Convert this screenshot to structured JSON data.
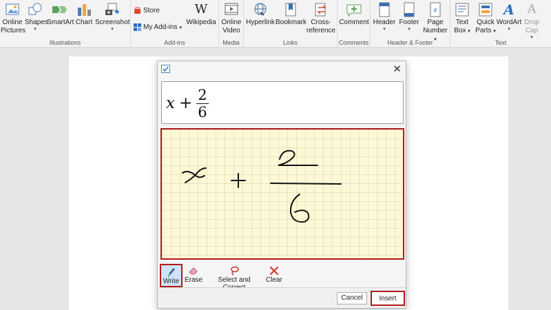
{
  "ribbon": {
    "illustrations": {
      "label": "Illustrations",
      "online_pictures": "Online Pictures",
      "shapes": "Shapes",
      "smartart": "SmartArt",
      "chart": "Chart",
      "screenshot": "Screenshot"
    },
    "addins": {
      "label": "Add-ins",
      "store": "Store",
      "my_addins": "My Add-ins",
      "wikipedia": "Wikipedia"
    },
    "media": {
      "label": "Media",
      "online_video": "Online Video"
    },
    "links": {
      "label": "Links",
      "hyperlink": "Hyperlink",
      "bookmark": "Bookmark",
      "cross_reference": "Cross-reference"
    },
    "comments": {
      "label": "Comments",
      "comment": "Comment"
    },
    "header_footer": {
      "label": "Header & Footer",
      "header": "Header",
      "footer": "Footer",
      "page_number": "Page Number"
    },
    "text": {
      "label": "Text",
      "text_box": "Text Box",
      "quick_parts": "Quick Parts",
      "wordart": "WordArt",
      "drop_cap": "Drop Cap"
    }
  },
  "dialog": {
    "preview": {
      "var": "x",
      "plus": "+",
      "numerator": "2",
      "denominator": "6"
    },
    "tools": {
      "write": "Write",
      "erase": "Erase",
      "select_correct": "Select and Correct",
      "clear": "Clear"
    },
    "cancel": "Cancel",
    "insert": "Insert"
  },
  "colors": {
    "accent_red": "#b01a1a",
    "canvas_bg": "#fdf8d6",
    "ribbon_bg": "#f3f3f3"
  }
}
